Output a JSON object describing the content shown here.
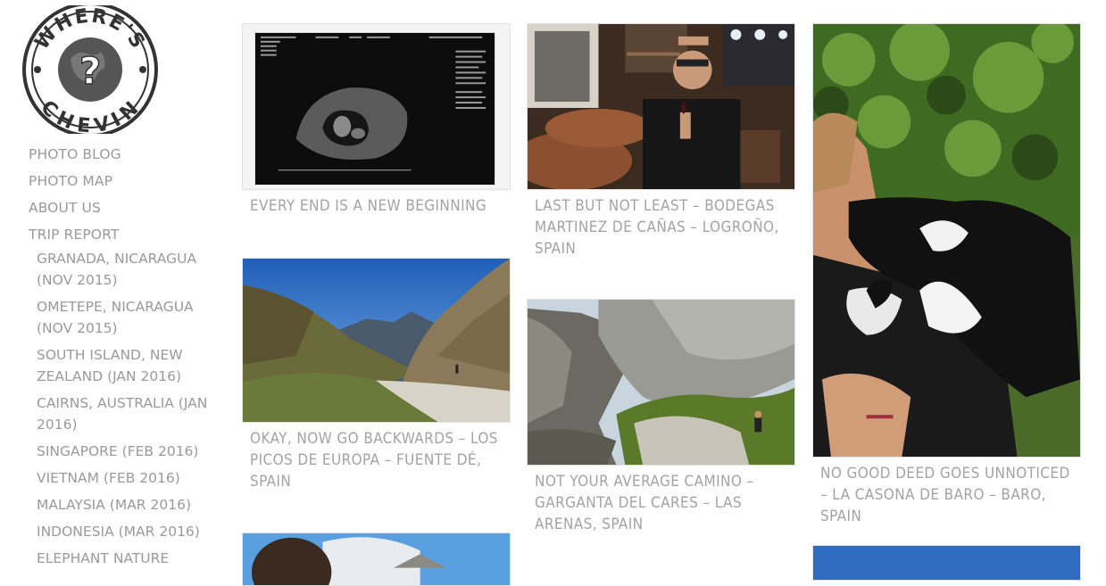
{
  "site": {
    "logo_top": "WHERE'S",
    "logo_bottom": "CHEVIN",
    "logo_mark": "?"
  },
  "nav": {
    "items": [
      "PHOTO BLOG",
      "PHOTO MAP",
      "ABOUT US",
      "TRIP REPORT"
    ],
    "trip_reports": [
      "GRANADA, NICARAGUA (NOV 2015)",
      "OMETEPE, NICARAGUA (NOV 2015)",
      "SOUTH ISLAND, NEW ZEALAND (JAN 2016)",
      "CAIRNS, AUSTRALIA (JAN 2016)",
      "SINGAPORE (FEB 2016)",
      "VIETNAM (FEB 2016)",
      "MALAYSIA (MAR 2016)",
      "INDONESIA (MAR 2016)",
      "ELEPHANT NATURE"
    ]
  },
  "posts": [
    {
      "title": "EVERY END IS A NEW BEGINNING",
      "image": "ultrasound scan photo"
    },
    {
      "title": "LAST BUT NOT LEAST – BODEGAS MARTINEZ DE CAÑAS – LOGROÑO, SPAIN",
      "image": "man with wine glass among barrels"
    },
    {
      "title": "NO GOOD DEED GOES UNNOTICED – LA CASONA DE BARO – BARO, SPAIN",
      "image": "woman with puppy and dog"
    },
    {
      "title": "OKAY, NOW GO BACKWARDS – LOS PICOS DE EUROPA – FUENTE DÉ, SPAIN",
      "image": "mountain valley with gravel road"
    },
    {
      "title": "NOT YOUR AVERAGE CAMINO – GARGANTA DEL CARES – LAS ARENAS, SPAIN",
      "image": "rocky gorge with hiker"
    },
    {
      "title": "",
      "image": "person under blue sky"
    },
    {
      "title": "",
      "image": "blue sky"
    }
  ]
}
